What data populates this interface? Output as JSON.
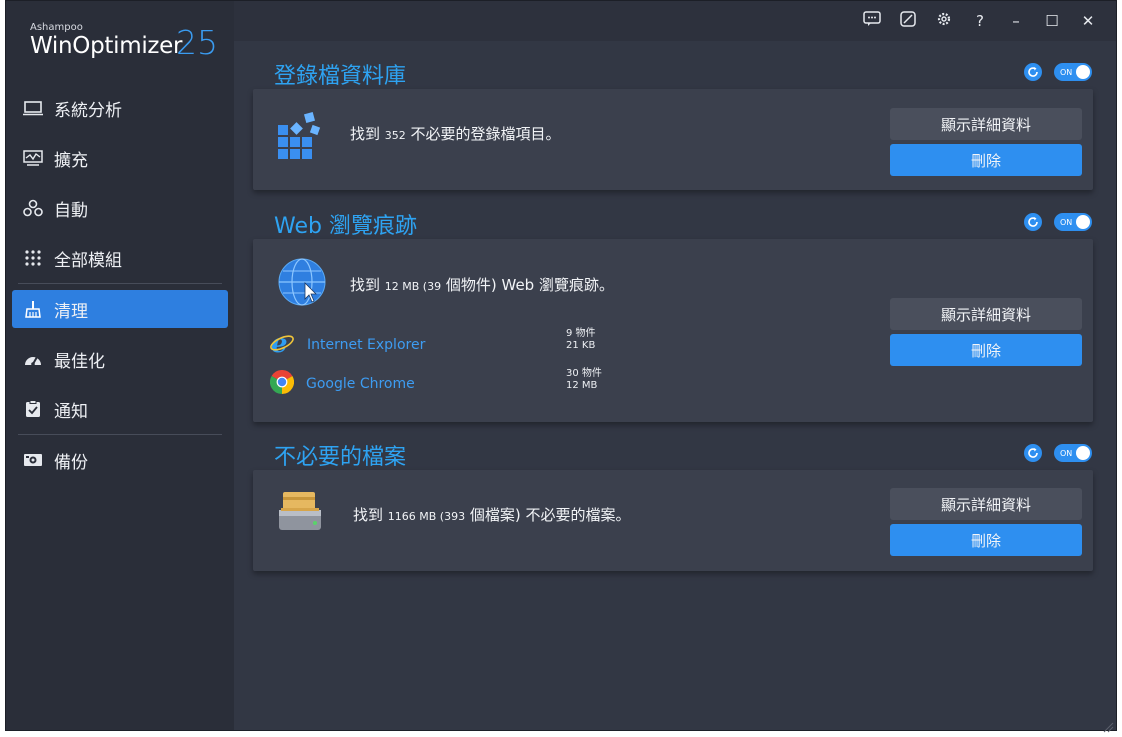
{
  "app": {
    "brand": "Ashampoo",
    "name": "WinOptimizer",
    "version": "25"
  },
  "titlebar": {
    "feedback_icon": "feedback-icon",
    "skin_icon": "theme-icon",
    "settings_icon": "gear-icon",
    "help": "?",
    "minimize": "–",
    "maximize": "☐",
    "close": "✕"
  },
  "nav": [
    {
      "label": "系統分析",
      "icon": "monitor-icon"
    },
    {
      "label": "擴充",
      "icon": "chart-icon"
    },
    {
      "label": "自動",
      "icon": "automation-icon"
    },
    {
      "label": "全部模組",
      "icon": "grid-icon"
    },
    {
      "label": "清理",
      "icon": "broom-icon",
      "active": true
    },
    {
      "label": "最佳化",
      "icon": "speedometer-icon"
    },
    {
      "label": "通知",
      "icon": "clipboard-check-icon"
    },
    {
      "label": "備份",
      "icon": "backup-icon"
    }
  ],
  "sections": {
    "registry": {
      "title": "登錄檔資料庫",
      "toggle": "ON",
      "text_prefix": "找到 ",
      "count": "352",
      "text_suffix": " 不必要的登錄檔項目。",
      "details": "顯示詳細資料",
      "delete": "刪除"
    },
    "web": {
      "title": "Web 瀏覽痕跡",
      "toggle": "ON",
      "text_prefix": "找到 ",
      "count": "12 MB (39",
      "text_suffix": " 個物件) Web 瀏覽痕跡。",
      "details": "顯示詳細資料",
      "delete": "刪除",
      "browsers": [
        {
          "name": "Internet Explorer",
          "items": "9 物件",
          "size": "21 KB"
        },
        {
          "name": "Google Chrome",
          "items": "30 物件",
          "size": "12 MB"
        }
      ]
    },
    "files": {
      "title": "不必要的檔案",
      "toggle": "ON",
      "text_prefix": "找到 ",
      "count": "1166 MB (393",
      "text_suffix": " 個檔案) 不必要的檔案。",
      "details": "顯示詳細資料",
      "delete": "刪除"
    }
  },
  "colors": {
    "accent": "#2e8ff0",
    "title": "#2ea3f2",
    "background": "#323744",
    "card": "#3b404d"
  }
}
